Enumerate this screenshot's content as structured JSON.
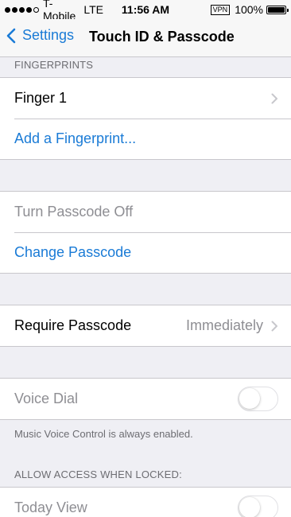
{
  "status_bar": {
    "carrier": "T-Mobile",
    "network": "LTE",
    "time": "11:56 AM",
    "vpn": "VPN",
    "battery_percent": "100%",
    "battery_level": 1.0
  },
  "nav": {
    "back_label": "Settings",
    "title": "Touch ID & Passcode"
  },
  "fingerprints": {
    "header": "FINGERPRINTS",
    "finger1": "Finger 1",
    "add": "Add a Fingerprint..."
  },
  "passcode": {
    "turn_off": "Turn Passcode Off",
    "change": "Change Passcode"
  },
  "require": {
    "label": "Require Passcode",
    "value": "Immediately"
  },
  "voice": {
    "label": "Voice Dial",
    "enabled": false,
    "note": "Music Voice Control is always enabled."
  },
  "locked": {
    "header": "ALLOW ACCESS WHEN LOCKED:",
    "today_view": "Today View",
    "today_view_enabled": false
  }
}
